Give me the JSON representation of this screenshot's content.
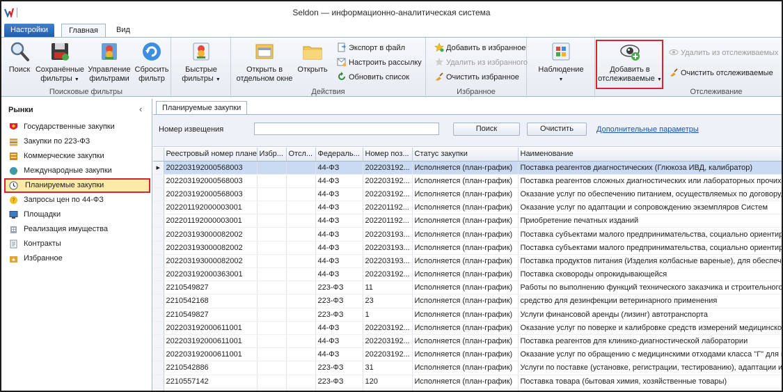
{
  "window": {
    "title": "Seldon — информационно-аналитическая система"
  },
  "tabs": [
    {
      "label": "Настройки"
    },
    {
      "label": "Главная"
    },
    {
      "label": "Вид"
    }
  ],
  "ribbon": {
    "search_filters": {
      "label": "Поисковые фильтры",
      "search": "Поиск",
      "saved_filters": [
        "Сохранённые",
        "фильтры"
      ],
      "manage_filters": [
        "Управление",
        "фильтрами"
      ],
      "reset_filter": [
        "Сбросить",
        "фильтр"
      ]
    },
    "quick_filters": [
      "Быстрые",
      "фильтры"
    ],
    "actions": {
      "label": "Действия",
      "open_new_window": [
        "Открыть в",
        "отдельном окне"
      ],
      "open": "Открыть",
      "export": "Экспорт в файл",
      "mailing": "Настроить рассылку",
      "refresh": "Обновить список"
    },
    "favorites": {
      "label": "Избранное",
      "add": "Добавить в избранное",
      "remove": "Удалить из избранного",
      "clear": "Очистить избранное"
    },
    "observe": "Наблюдение",
    "tracking": {
      "label": "Отслеживание",
      "add": [
        "Добавить в",
        "отслеживаемые"
      ],
      "remove": "Удалить из отслеживаемых",
      "clear": "Очистить отслеживаемые"
    }
  },
  "nav": {
    "header": "Рынки",
    "items": [
      "Государственные закупки",
      "Закупки по 223-ФЗ",
      "Коммерческие закупки",
      "Международные закупки",
      "Планируемые закупки",
      "Запросы цен по 44-ФЗ",
      "Площадки",
      "Реализация имущества",
      "Контракты",
      "Избранное"
    ]
  },
  "content": {
    "tab": "Планируемые закупки",
    "search": {
      "label": "Номер извещения",
      "value": "",
      "search_button": "Поиск",
      "clear_button": "Очистить",
      "advanced_link": "Дополнительные параметры"
    },
    "columns": [
      "Реестровый номер плане...",
      "Избр...",
      "Отсл...",
      "Федераль...",
      "Номер поз...",
      "Статус закупки",
      "Наименование"
    ],
    "rows": [
      [
        "202203192000568003",
        "",
        "",
        "44-ФЗ",
        "202203192...",
        "Исполняется (план-график)",
        "Поставка реагентов диагностических (Глюкоза ИВД, калибратор)"
      ],
      [
        "202203192000568003",
        "",
        "",
        "44-ФЗ",
        "202203192...",
        "Исполняется (план-график)",
        "Поставка реагентов сложных диагностических или лабораторных прочих, в"
      ],
      [
        "202203192000568003",
        "",
        "",
        "44-ФЗ",
        "202203192...",
        "Исполняется (план-график)",
        "Оказание услуг по обеспечению питанием, осуществляемых по договору, п"
      ],
      [
        "202201192000003001",
        "",
        "",
        "44-ФЗ",
        "202201192...",
        "Исполняется (план-график)",
        "Оказание услуг по адаптации и сопровождению экземпляров Систем"
      ],
      [
        "202201192000003001",
        "",
        "",
        "44-ФЗ",
        "202201192...",
        "Исполняется (план-график)",
        "Приобретение печатных изданий"
      ],
      [
        "202203193000082002",
        "",
        "",
        "44-ФЗ",
        "202203193...",
        "Исполняется (план-график)",
        "Поставка субъектами малого предпринимательства, социально ориентиров"
      ],
      [
        "202203193000082002",
        "",
        "",
        "44-ФЗ",
        "202203193...",
        "Исполняется (план-график)",
        "Поставка субъектами малого предпринимательства, социально ориентиров"
      ],
      [
        "202203193000082002",
        "",
        "",
        "44-ФЗ",
        "202203193...",
        "Исполняется (план-график)",
        "Поставка продуктов питания (Изделия колбасные вареные), для обеспечен"
      ],
      [
        "202203192000363001",
        "",
        "",
        "44-ФЗ",
        "202203192...",
        "Исполняется (план-график)",
        "Поставка сковороды опрокидывающейся"
      ],
      [
        "2210549827",
        "",
        "",
        "223-ФЗ",
        "11",
        "Исполняется (план-график)",
        "Работы по выполнению функций технического заказчика и строительного"
      ],
      [
        "2210542168",
        "",
        "",
        "223-ФЗ",
        "23",
        "Исполняется (план-график)",
        "средство для дезинфекции ветеринарного применения"
      ],
      [
        "2210549827",
        "",
        "",
        "223-ФЗ",
        "1",
        "Исполняется (план-график)",
        "Услуги финансовой аренды (лизинг) автотранспорта"
      ],
      [
        "202203192000611001",
        "",
        "",
        "44-ФЗ",
        "202203192...",
        "Исполняется (план-график)",
        "Оказание услуг по поверке и калибровке средств измерений медицинского"
      ],
      [
        "202203192000611001",
        "",
        "",
        "44-ФЗ",
        "202203192...",
        "Исполняется (план-график)",
        "Поставка реагентов для клинико-диагностической лаборатории"
      ],
      [
        "202203192000611001",
        "",
        "",
        "44-ФЗ",
        "202203192...",
        "Исполняется (план-график)",
        "Оказание услуг по обращению с медицинскими отходами класса \"Г\" для нуж"
      ],
      [
        "2210542886",
        "",
        "",
        "223-ФЗ",
        "31",
        "Исполняется (план-график)",
        "Услуги по поставке (установке, регистрации, тестированию), адаптации и"
      ],
      [
        "2210557142",
        "",
        "",
        "223-ФЗ",
        "120",
        "Исполняется (план-график)",
        "Поставка товара (бытовая химия, хозяйственные товары)"
      ],
      [
        "",
        "",
        "",
        "",
        "",
        "",
        ""
      ]
    ]
  },
  "colors": {
    "accent": "#2a66b8",
    "highlight_border": "#d9232d",
    "selected_row": "#c9daf2",
    "active_nav": "#fde9a8"
  }
}
